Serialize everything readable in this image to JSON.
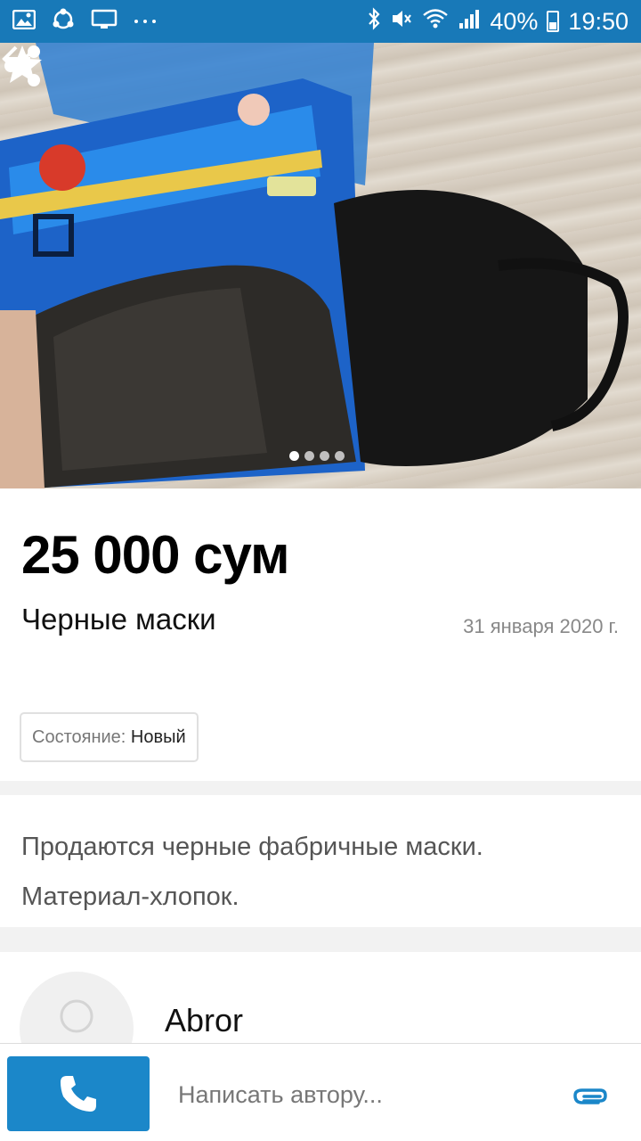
{
  "status_bar": {
    "battery": "40%",
    "time": "19:50"
  },
  "listing": {
    "price": "25 000 сум",
    "title": "Черные маски",
    "date": "31 января 2020 г.",
    "condition_label": "Состояние:",
    "condition_value": "Новый",
    "description_line1": "Продаются черные фабричные маски.",
    "description_line2": "Материал-хлопок.",
    "image_count": 4,
    "active_image": 1
  },
  "seller": {
    "name": "Abror"
  },
  "bottom_bar": {
    "message_placeholder": "Написать автору..."
  },
  "colors": {
    "status_bar": "#1879b8",
    "call_button": "#1b87c9"
  }
}
